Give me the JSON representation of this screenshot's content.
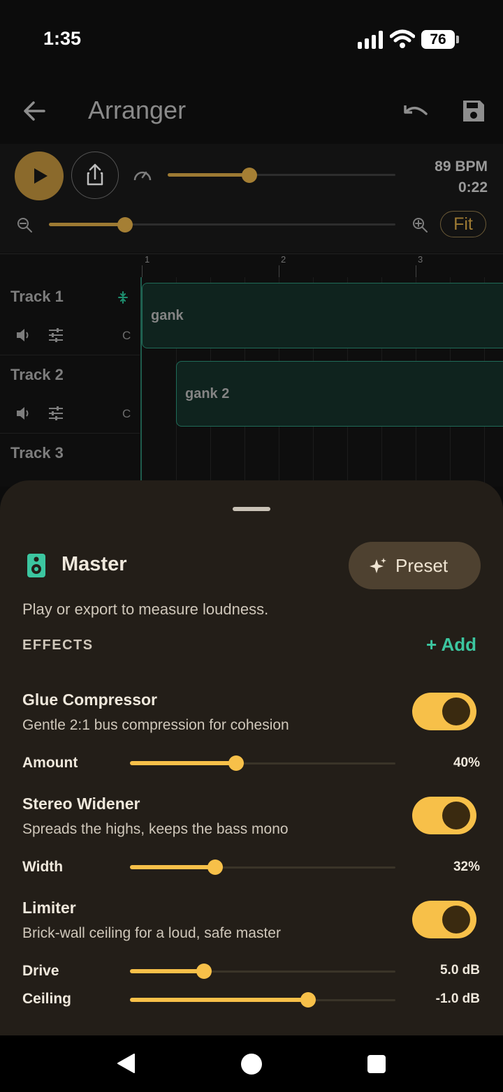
{
  "status_bar": {
    "time": "1:35",
    "battery": "76"
  },
  "app_bar": {
    "title": "Arranger",
    "back_icon": "arrow-left-icon",
    "undo_icon": "undo-icon",
    "save_icon": "save-icon"
  },
  "transport": {
    "bpm": "89 BPM",
    "position": "0:22",
    "tempo_level": 0.36,
    "zoom_level": 0.22,
    "fit_label": "Fit"
  },
  "ruler": {
    "marks": [
      "1",
      "2",
      "3"
    ]
  },
  "tracks": [
    {
      "name": "Track 1",
      "pan": "C",
      "clip": "gank"
    },
    {
      "name": "Track 2",
      "pan": "C",
      "clip": "gank 2"
    },
    {
      "name": "Track 3"
    }
  ],
  "master": {
    "title": "Master",
    "preset_label": "Preset",
    "hint": "Play or export to measure loudness.",
    "effects_heading": "EFFECTS",
    "add_label": "+ Add",
    "effects": [
      {
        "title": "Glue Compressor",
        "desc": "Gentle 2:1 bus compression for cohesion",
        "enabled": true,
        "params": [
          {
            "label": "Amount",
            "value": "40%",
            "level": 0.4
          }
        ]
      },
      {
        "title": "Stereo Widener",
        "desc": "Spreads the highs, keeps the bass mono",
        "enabled": true,
        "params": [
          {
            "label": "Width",
            "value": "32%",
            "level": 0.32
          }
        ]
      },
      {
        "title": "Limiter",
        "desc": "Brick-wall ceiling for a loud, safe master",
        "enabled": true,
        "params": [
          {
            "label": "Drive",
            "value": "5.0 dB",
            "level": 0.28
          },
          {
            "label": "Ceiling",
            "value": "-1.0 dB",
            "level": 0.67
          }
        ]
      }
    ]
  },
  "colors": {
    "accent": "#f7c049",
    "clip_border": "#1f6b58",
    "add": "#3cc6a0",
    "sheet": "#231e18"
  }
}
